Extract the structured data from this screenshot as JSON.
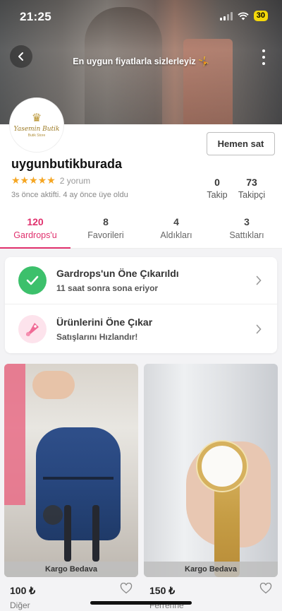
{
  "status_bar": {
    "time": "21:25",
    "battery": "30"
  },
  "cover": {
    "tagline": "En uygun fiyatlarla sizlerleyiz 🤸"
  },
  "avatar": {
    "logo_name": "Yasemin Butik",
    "logo_sub": "Butik Store"
  },
  "header": {
    "sell_button": "Hemen sat"
  },
  "profile": {
    "username": "uygunbutikburada",
    "stars": "★★★★★",
    "review_count": "2 yorum",
    "activity": "3s önce aktifti. 4 ay önce üye oldu",
    "following": {
      "count": "0",
      "label": "Takip"
    },
    "followers": {
      "count": "73",
      "label": "Takipçi"
    }
  },
  "tabs": [
    {
      "count": "120",
      "label": "Gardrops'u"
    },
    {
      "count": "8",
      "label": "Favorileri"
    },
    {
      "count": "4",
      "label": "Aldıkları"
    },
    {
      "count": "3",
      "label": "Sattıkları"
    }
  ],
  "promo": {
    "featured": {
      "title": "Gardrops'un Öne Çıkarıldı",
      "subtitle": "11 saat sonra sona eriyor"
    },
    "boost": {
      "title": "Ürünlerini Öne Çıkar",
      "subtitle": "Satışlarını Hızlandır!"
    }
  },
  "products": [
    {
      "shipping": "Kargo Bedava",
      "price": "100 ₺",
      "brand": "Diğer"
    },
    {
      "shipping": "Kargo Bedava",
      "price": "150 ₺",
      "brand": "Ferrerine"
    }
  ],
  "colors": {
    "accent": "#e0306d",
    "success": "#3cc06b",
    "star": "#f5a623"
  }
}
